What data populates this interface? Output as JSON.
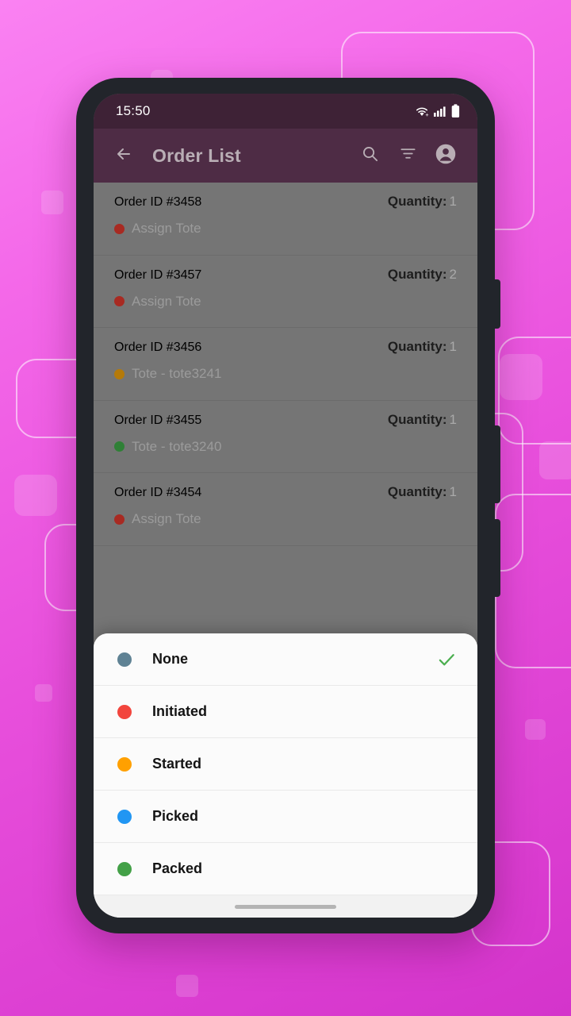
{
  "wallpaper": {
    "gradient_from": "#fa82f2",
    "gradient_to": "#d434cb"
  },
  "device": {
    "frame_color": "#22252b"
  },
  "status_bar": {
    "time": "15:50",
    "icons": [
      "wifi-icon",
      "cellular-signal-icon",
      "battery-icon"
    ]
  },
  "app_bar": {
    "back_icon": "back-arrow-icon",
    "title": "Order List",
    "actions": [
      {
        "name": "search-icon",
        "label": "Search"
      },
      {
        "name": "filter-icon",
        "label": "Filter"
      },
      {
        "name": "account-icon",
        "label": "Account"
      }
    ],
    "background": "#4e2c45",
    "title_color": "#b9aeb5"
  },
  "order_list": {
    "quantity_label": "Quantity:",
    "rows": [
      {
        "order_id": "Order ID #3458",
        "quantity": "1",
        "status_text": "Assign Tote",
        "status_color": "#a82a22"
      },
      {
        "order_id": "Order ID #3457",
        "quantity": "2",
        "status_text": "Assign Tote",
        "status_color": "#a82a22"
      },
      {
        "order_id": "Order ID #3456",
        "quantity": "1",
        "status_text": "Tote - tote3241",
        "status_color": "#b57a09"
      },
      {
        "order_id": "Order ID #3455",
        "quantity": "1",
        "status_text": "Tote - tote3240",
        "status_color": "#2f8036"
      },
      {
        "order_id": "Order ID #3454",
        "quantity": "1",
        "status_text": "Assign Tote",
        "status_color": "#a82a22"
      }
    ],
    "scrim_color": "#757575"
  },
  "status_filter_sheet": {
    "options": [
      {
        "label": "None",
        "color": "#5f8294",
        "selected": true
      },
      {
        "label": "Initiated",
        "color": "#f2453d",
        "selected": false
      },
      {
        "label": "Started",
        "color": "#ffa000",
        "selected": false
      },
      {
        "label": "Picked",
        "color": "#2196f3",
        "selected": false
      },
      {
        "label": "Packed",
        "color": "#43a047",
        "selected": false
      }
    ],
    "check_icon": "check-icon",
    "check_color": "#4caf50"
  },
  "navigation_bar": {
    "handle": "gesture-handle"
  }
}
